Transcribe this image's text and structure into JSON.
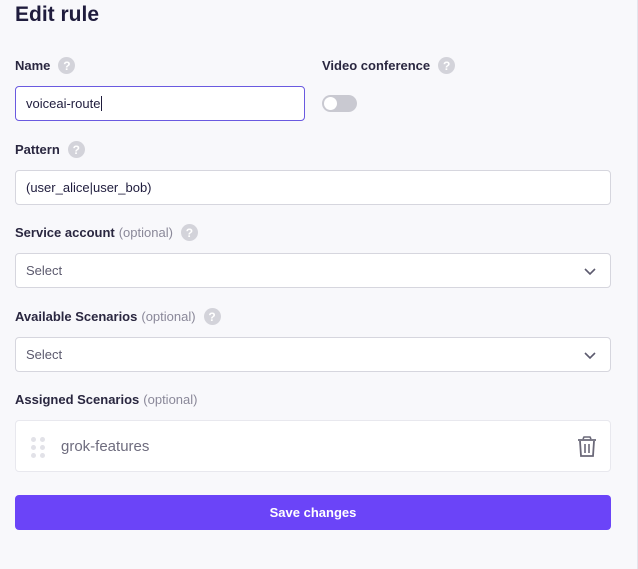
{
  "page": {
    "title": "Edit rule"
  },
  "name_field": {
    "label": "Name",
    "value": "voiceai-route"
  },
  "video_conference": {
    "label": "Video conference",
    "enabled": false
  },
  "pattern_field": {
    "label": "Pattern",
    "value": "(user_alice|user_bob)"
  },
  "service_account": {
    "label": "Service account",
    "optional": "(optional)",
    "selected": "Select"
  },
  "available_scenarios": {
    "label": "Available Scenarios",
    "optional": "(optional)",
    "selected": "Select"
  },
  "assigned_scenarios": {
    "label": "Assigned Scenarios",
    "optional": "(optional)",
    "items": [
      {
        "name": "grok-features"
      }
    ]
  },
  "actions": {
    "save_label": "Save changes"
  },
  "icons": {
    "help": "question-circle-icon",
    "chevron": "chevron-down-icon",
    "delete": "trash-icon",
    "drag": "drag-handle-icon"
  },
  "colors": {
    "primary": "#6b44f8",
    "focus_border": "#6a5ae0",
    "help_icon": "#d3d3da",
    "toggle_off": "#c9c9d1"
  }
}
